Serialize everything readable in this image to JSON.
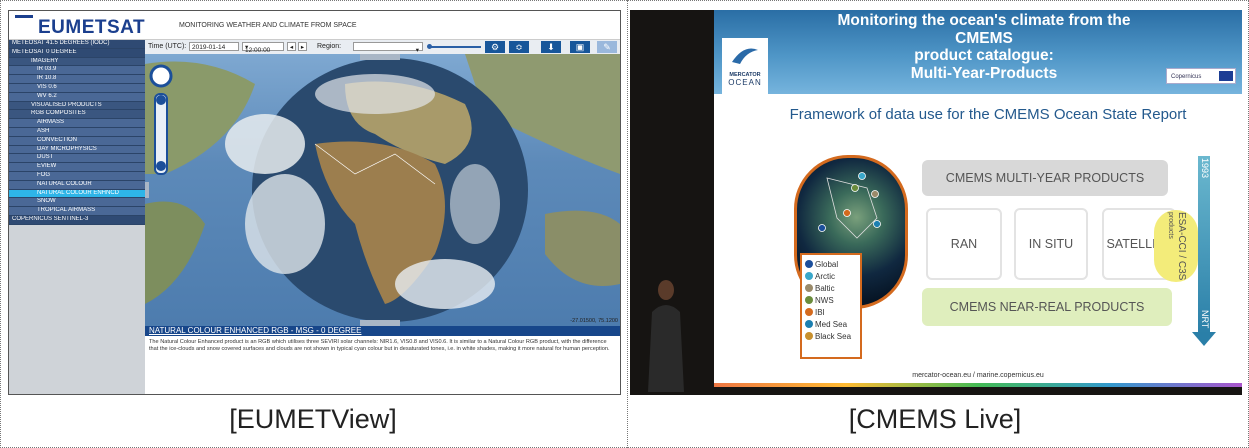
{
  "captions": {
    "left": "[EUMETView]",
    "right": "[CMEMS  Live]"
  },
  "eumetview": {
    "logo": "EUMETSAT",
    "tagline": "MONITORING WEATHER AND CLIMATE FROM SPACE",
    "time_label": "Time (UTC):",
    "date_value": "2019-01-14",
    "time_value": "12:00:00",
    "region_label": "Region:",
    "region_value": "",
    "toolbar_icons": [
      "gear-icon",
      "layers-icon",
      "download-icon",
      "save-icon",
      "edit-icon"
    ],
    "sidebar": [
      {
        "label": "METEOSAT 41.5 DEGREES (IODC)",
        "level": 0
      },
      {
        "label": "METEOSAT 0 DEGREE",
        "level": 0
      },
      {
        "label": "IMAGERY",
        "level": 1
      },
      {
        "label": "IR 03.9",
        "level": 2
      },
      {
        "label": "IR 10.8",
        "level": 2
      },
      {
        "label": "VIS 0.6",
        "level": 2
      },
      {
        "label": "WV 6.2",
        "level": 2
      },
      {
        "label": "VISUALISED PRODUCTS",
        "level": 1
      },
      {
        "label": "RGB COMPOSITES",
        "level": 1
      },
      {
        "label": "AIRMASS",
        "level": 2
      },
      {
        "label": "ASH",
        "level": 2
      },
      {
        "label": "CONVECTION",
        "level": 2
      },
      {
        "label": "DAY MICROPHYSICS",
        "level": 2
      },
      {
        "label": "DUST",
        "level": 2
      },
      {
        "label": "EVIEW",
        "level": 2
      },
      {
        "label": "FOG",
        "level": 2
      },
      {
        "label": "NATURAL COLOUR",
        "level": 2
      },
      {
        "label": "NATURAL COLOUR ENHNCD",
        "level": 2,
        "selected": true
      },
      {
        "label": "SNOW",
        "level": 2
      },
      {
        "label": "TROPICAL AIRMASS",
        "level": 2
      },
      {
        "label": "COPERNICUS SENTINEL-3",
        "level": 0
      }
    ],
    "coords": "-27.01500, 75.1200",
    "info_title": "NATURAL COLOUR ENHANCED RGB - MSG - 0 DEGREE",
    "info_text": "The Natural Colour Enhanced product is an RGB which utilises three SEVIRI solar channels: NIR1.6, VIS0.8 and VIS0.6. It is similar to a Natural Colour RGB product, with the difference that the ice-clouds and snow covered surfaces and clouds are not shown in typical cyan colour but in desaturated tones, i.e. in white shades, making it more natural for human perception."
  },
  "cmems": {
    "title_line1": "Monitoring the ocean's climate from the CMEMS",
    "title_line2": "product catalogue:",
    "title_line3": "Multi-Year-Products",
    "mercator_line1": "MERCATOR",
    "mercator_line2": "OCEAN",
    "copernicus": "Copernicus",
    "subtitle": "Framework of data use for the CMEMS Ocean State Report",
    "multi_year": "CMEMS MULTI-YEAR PRODUCTS",
    "ran": "RAN",
    "in_situ": "IN SITU",
    "satellite": "SATELLITE",
    "esa_cci": "ESA-CCI / C3S",
    "esa_products": "products",
    "near_real": "CMEMS NEAR-REAL PRODUCTS",
    "arrow_top": "1993",
    "arrow_bottom": "NRT",
    "legend": [
      {
        "n": "1",
        "label": "Global",
        "color": "#1c4f9c"
      },
      {
        "n": "2",
        "label": "Arctic",
        "color": "#3aa7c9"
      },
      {
        "n": "3",
        "label": "Baltic",
        "color": "#9a8a6a"
      },
      {
        "n": "4",
        "label": "NWS",
        "color": "#6a8c3c"
      },
      {
        "n": "5",
        "label": "IBI",
        "color": "#d46a1e"
      },
      {
        "n": "6",
        "label": "Med Sea",
        "color": "#1c7fb0"
      },
      {
        "n": "7",
        "label": "Black Sea",
        "color": "#c8902e"
      }
    ],
    "footer": "mercator-ocean.eu / marine.copernicus.eu"
  }
}
